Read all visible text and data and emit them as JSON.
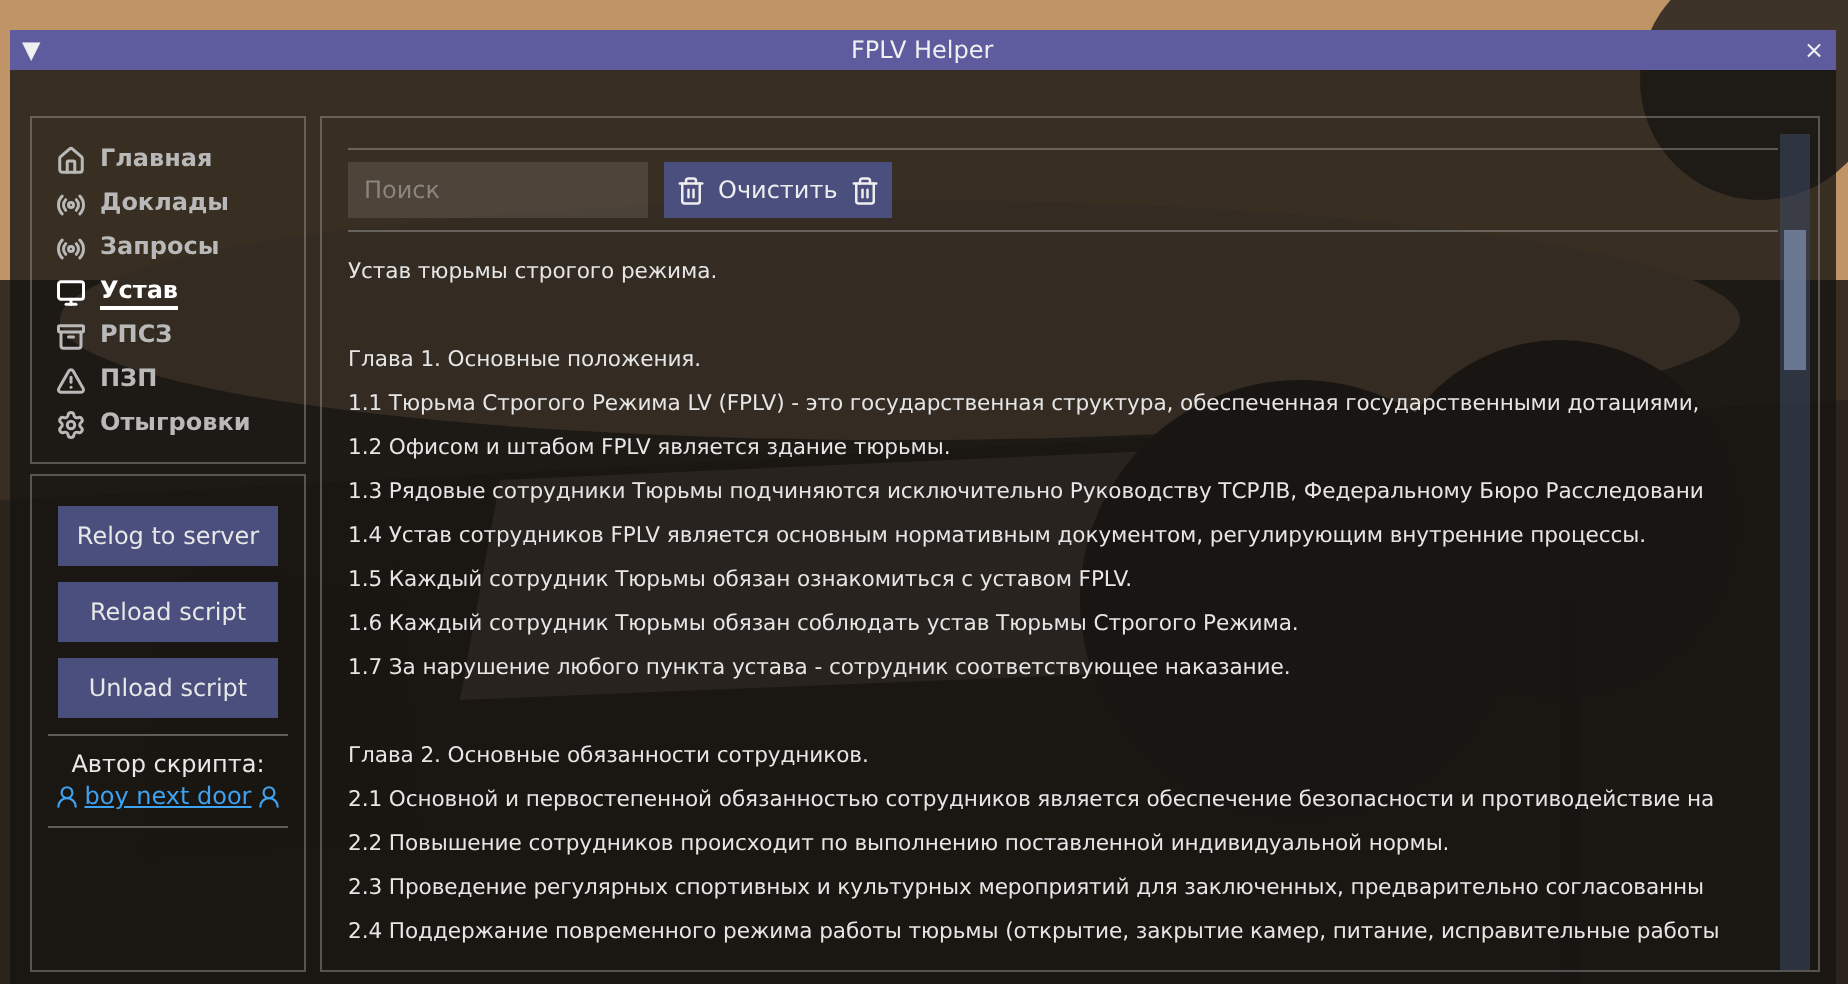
{
  "window": {
    "title": "FPLV Helper",
    "menu_glyph": "▼",
    "close_glyph": "×"
  },
  "nav": [
    {
      "label": "Главная",
      "selected": false
    },
    {
      "label": "Доклады",
      "selected": false
    },
    {
      "label": "Запросы",
      "selected": false
    },
    {
      "label": "Устав",
      "selected": true
    },
    {
      "label": "РПСЗ",
      "selected": false
    },
    {
      "label": "ПЗП",
      "selected": false
    },
    {
      "label": "Отыгровки",
      "selected": false
    }
  ],
  "actions": [
    "Relog to server",
    "Reload script",
    "Unload script"
  ],
  "author": {
    "label": "Автор скрипта:",
    "name": "boy next door"
  },
  "search": {
    "placeholder": "Поиск"
  },
  "clear_button": "Очистить",
  "document": {
    "title": "Устав тюрьмы строгого режима.",
    "sections": [
      {
        "heading": "Глава 1. Основные положения.",
        "items": [
          "1.1 Тюрьма Строгого Режима LV (FPLV) - это государственная структура, обеспеченная государственными дотациями,",
          "1.2 Офисом и штабом FPLV является здание тюрьмы.",
          "1.3 Рядовые сотрудники Тюрьмы подчиняются исключительно Руководству ТСРЛВ, Федеральному Бюро Расследовани",
          "1.4 Устав сотрудников FPLV является основным нормативным документом, регулирующим внутренние процессы.",
          "1.5 Каждый сотрудник Тюрьмы обязан ознакомиться с уставом FPLV.",
          "1.6 Каждый сотрудник Тюрьмы обязан соблюдать устав Тюрьмы Строгого Режима.",
          "1.7 За нарушение любого пункта устава - сотрудник соответствующее наказание."
        ]
      },
      {
        "heading": "Глава 2. Основные обязанности сотрудников.",
        "items": [
          "2.1 Основной и первостепенной обязанностью сотрудников является обеспечение безопасности и противодействие на",
          "2.2 Повышение сотрудников происходит по выполнению поставленной индивидуальной нормы.",
          "2.3 Проведение регулярных спортивных и культурных мероприятий для заключенных, предварительно согласованны",
          "2.4 Поддержание повременного режима работы тюрьмы (открытие, закрытие камер, питание, исправительные работы"
        ]
      }
    ]
  }
}
